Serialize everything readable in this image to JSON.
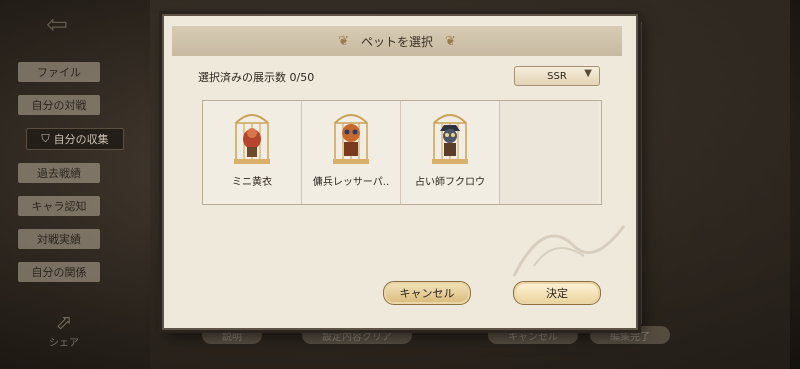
{
  "side_menu": {
    "items": [
      {
        "label": "ファイル",
        "active": false
      },
      {
        "label": "自分の対戦",
        "active": false
      },
      {
        "label": "自分の収集",
        "active": true
      },
      {
        "label": "過去戦績",
        "active": false
      },
      {
        "label": "キャラ認知",
        "active": false
      },
      {
        "label": "対戦実績",
        "active": false
      },
      {
        "label": "自分の関係",
        "active": false
      }
    ],
    "share_label": "シェア"
  },
  "bottom_bar": {
    "buttons": [
      "説明",
      "設定内容クリア",
      "キャンセル",
      "編集完了"
    ]
  },
  "dialog": {
    "title": "ペットを選択",
    "count_label": "選択済みの展示数 0/50",
    "rarity_filter": "SSR",
    "pets": [
      {
        "name": "ミニ黄衣",
        "icon": "mini-yellow-robe-pet-icon"
      },
      {
        "name": "傭兵レッサーパ..",
        "icon": "mercenary-red-panda-pet-icon"
      },
      {
        "name": "占い師フクロウ",
        "icon": "fortune-teller-owl-pet-icon"
      }
    ],
    "cancel_label": "キャンセル",
    "confirm_label": "決定"
  }
}
